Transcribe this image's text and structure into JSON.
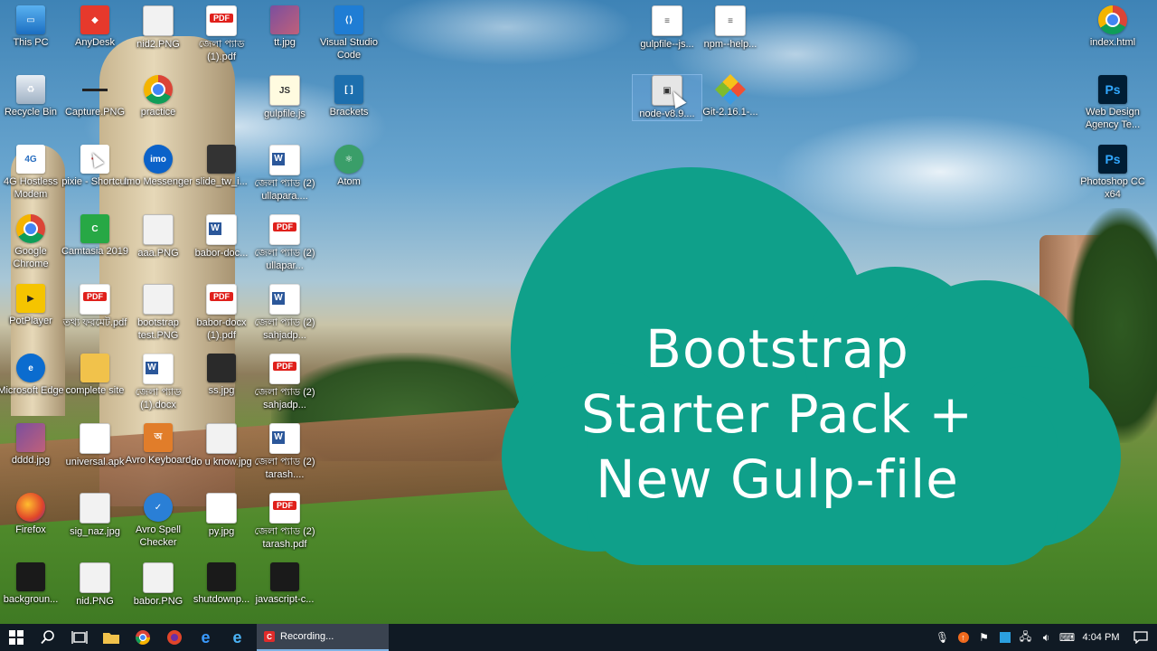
{
  "desktop": {
    "icons": [
      {
        "id": "this-pc",
        "label": "This PC",
        "icon": "pc"
      },
      {
        "id": "anydesk",
        "label": "AnyDesk",
        "icon": "anydesk"
      },
      {
        "id": "nid2",
        "label": "nid2.PNG",
        "icon": "png"
      },
      {
        "id": "pdf1",
        "label": "জেলা প্যাড (1).pdf",
        "icon": "pdf"
      },
      {
        "id": "ttjpg",
        "label": "tt.jpg",
        "icon": "image"
      },
      {
        "id": "vscode",
        "label": "Visual Studio Code",
        "icon": "vscode"
      },
      {
        "id": "recycle",
        "label": "Recycle Bin",
        "icon": "recycle-bin"
      },
      {
        "id": "capture",
        "label": "Capture.PNG",
        "icon": "png"
      },
      {
        "id": "practice",
        "label": "practice",
        "icon": "chrome"
      },
      {
        "id": "gulpfilejs",
        "label": "gulpfile.js",
        "icon": "js-file"
      },
      {
        "id": "brackets",
        "label": "Brackets",
        "icon": "brackets"
      },
      {
        "id": "modem",
        "label": "4G Hostless Modem",
        "icon": "modem"
      },
      {
        "id": "pixie",
        "label": "pixie - Shortcut",
        "icon": "pixie"
      },
      {
        "id": "imo",
        "label": "Imo Messenger",
        "icon": "imo"
      },
      {
        "id": "slide",
        "label": "slide_tw_i...",
        "icon": "image"
      },
      {
        "id": "ullapara-doc",
        "label": "জেলা প্যাড (2) ullapara....",
        "icon": "word"
      },
      {
        "id": "atom",
        "label": "Atom",
        "icon": "atom"
      },
      {
        "id": "chrome",
        "label": "Google Chrome",
        "icon": "chrome"
      },
      {
        "id": "camtasia",
        "label": "Camtasia 2019",
        "icon": "camtasia"
      },
      {
        "id": "aaa",
        "label": "aaa.PNG",
        "icon": "png"
      },
      {
        "id": "babor-doc",
        "label": "babor-doc...",
        "icon": "word"
      },
      {
        "id": "ullapar-pdf",
        "label": "জেলা প্যাড (2) ullapar...",
        "icon": "pdf"
      },
      {
        "id": "potplayer",
        "label": "PotPlayer",
        "icon": "potplayer"
      },
      {
        "id": "tottho",
        "label": "তথ্য ফরমেট.pdf",
        "icon": "pdf"
      },
      {
        "id": "bootstrap-test",
        "label": "bootstrap test.PNG",
        "icon": "png"
      },
      {
        "id": "babor-docx-pdf",
        "label": "babor-docx (1).pdf",
        "icon": "pdf"
      },
      {
        "id": "sahjadp-doc",
        "label": "জেলা প্যাড (2) sahjadp...",
        "icon": "word"
      },
      {
        "id": "edge",
        "label": "Microsoft Edge",
        "icon": "edge"
      },
      {
        "id": "complete-site",
        "label": "complete site",
        "icon": "folder"
      },
      {
        "id": "pad1-docx",
        "label": "জেলা প্যাড (1).docx",
        "icon": "word"
      },
      {
        "id": "ss",
        "label": "ss.jpg",
        "icon": "image"
      },
      {
        "id": "sahjadp-pdf",
        "label": "জেলা প্যাড (2) sahjadp...",
        "icon": "pdf"
      },
      {
        "id": "dddd",
        "label": "dddd.jpg",
        "icon": "image"
      },
      {
        "id": "universal",
        "label": "universal.apk",
        "icon": "apk"
      },
      {
        "id": "avro-kb",
        "label": "Avro Keyboard",
        "icon": "avro"
      },
      {
        "id": "doyouknow",
        "label": "do u know.jpg",
        "icon": "image"
      },
      {
        "id": "tarash-doc",
        "label": "জেলা প্যাড (2) tarash....",
        "icon": "word"
      },
      {
        "id": "firefox",
        "label": "Firefox",
        "icon": "firefox"
      },
      {
        "id": "signaz",
        "label": "sig_naz.jpg",
        "icon": "image"
      },
      {
        "id": "avro-spell",
        "label": "Avro Spell Checker",
        "icon": "spell-checker"
      },
      {
        "id": "py",
        "label": "py.jpg",
        "icon": "image"
      },
      {
        "id": "tarash-pdf",
        "label": "জেলা প্যাড (2) tarash.pdf",
        "icon": "pdf"
      },
      {
        "id": "background",
        "label": "backgroun...",
        "icon": "image"
      },
      {
        "id": "nid",
        "label": "nid.PNG",
        "icon": "png"
      },
      {
        "id": "babor-png",
        "label": "babor.PNG",
        "icon": "png"
      },
      {
        "id": "shutdown",
        "label": "shutdownp...",
        "icon": "image"
      },
      {
        "id": "javascript",
        "label": "javascript-c...",
        "icon": "image"
      },
      {
        "id": "gulpfile-js2",
        "label": "gulpfile--js...",
        "icon": "text-file"
      },
      {
        "id": "npm-help",
        "label": "npm--help...",
        "icon": "text-file"
      },
      {
        "id": "node",
        "label": "node-v8.9....",
        "icon": "installer"
      },
      {
        "id": "git",
        "label": "Git-2.16.1-...",
        "icon": "git"
      },
      {
        "id": "index-html",
        "label": "index.html",
        "icon": "chrome"
      },
      {
        "id": "web-design",
        "label": "Web Design Agency Te...",
        "icon": "photoshop"
      },
      {
        "id": "photoshop",
        "label": "Photoshop CC x64",
        "icon": "photoshop"
      }
    ]
  },
  "banner": {
    "line1": "Bootstrap",
    "line2": "Starter Pack +",
    "line3": "New Gulp-file",
    "color": "#0fa08a"
  },
  "taskbar": {
    "recording_label": "Recording...",
    "clock": "4:04 PM"
  }
}
